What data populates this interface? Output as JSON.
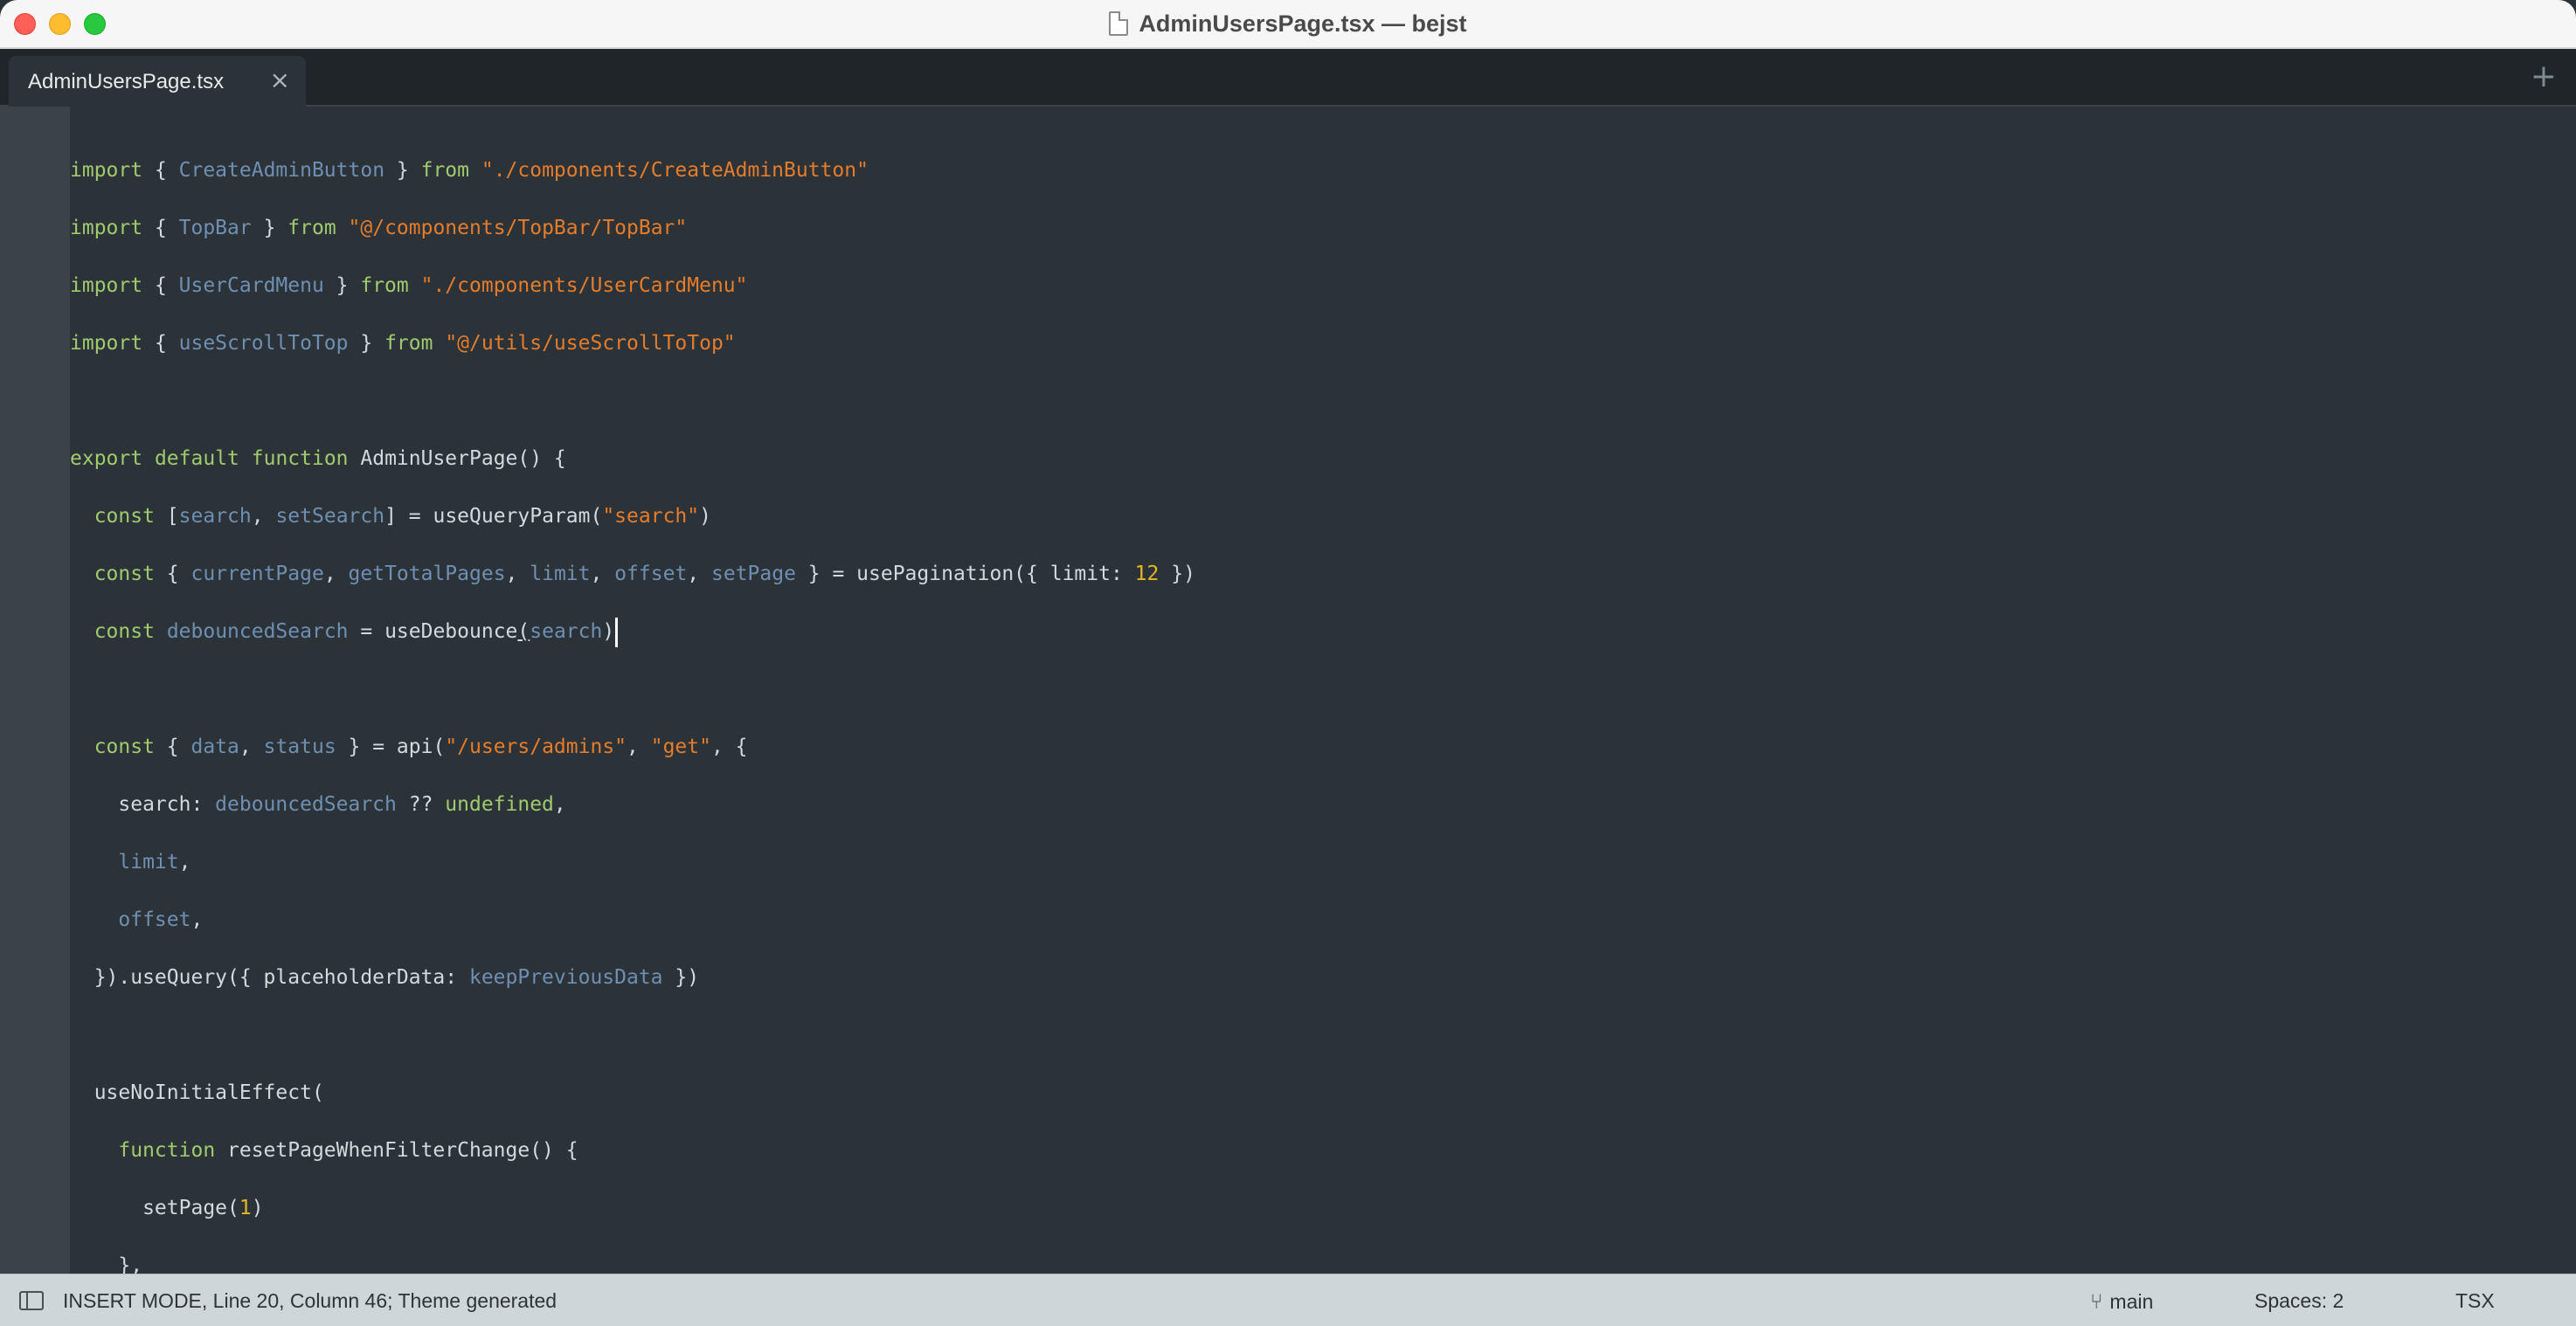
{
  "window": {
    "title": "AdminUsersPage.tsx — bejst"
  },
  "tabs": [
    {
      "label": "AdminUsersPage.tsx",
      "close": "×"
    }
  ],
  "new_tab_label": "+",
  "code": {
    "lines": [
      [
        [
          "kw",
          "import"
        ],
        [
          "p",
          " { "
        ],
        [
          "id",
          "CreateAdminButton"
        ],
        [
          "p",
          " } "
        ],
        [
          "kw",
          "from"
        ],
        [
          "p",
          " "
        ],
        [
          "str",
          "\"./components/CreateAdminButton\""
        ]
      ],
      [
        [
          "kw",
          "import"
        ],
        [
          "p",
          " { "
        ],
        [
          "id",
          "TopBar"
        ],
        [
          "p",
          " } "
        ],
        [
          "kw",
          "from"
        ],
        [
          "p",
          " "
        ],
        [
          "str",
          "\"@/components/TopBar/TopBar\""
        ]
      ],
      [
        [
          "kw",
          "import"
        ],
        [
          "p",
          " { "
        ],
        [
          "id",
          "UserCardMenu"
        ],
        [
          "p",
          " } "
        ],
        [
          "kw",
          "from"
        ],
        [
          "p",
          " "
        ],
        [
          "str",
          "\"./components/UserCardMenu\""
        ]
      ],
      [
        [
          "kw",
          "import"
        ],
        [
          "p",
          " { "
        ],
        [
          "id",
          "useScrollToTop"
        ],
        [
          "p",
          " } "
        ],
        [
          "kw",
          "from"
        ],
        [
          "p",
          " "
        ],
        [
          "str",
          "\"@/utils/useScrollToTop\""
        ]
      ],
      [],
      [
        [
          "kw",
          "export"
        ],
        [
          "p",
          " "
        ],
        [
          "kw",
          "default"
        ],
        [
          "p",
          " "
        ],
        [
          "kw",
          "function"
        ],
        [
          "p",
          " AdminUserPage() {"
        ]
      ],
      [
        [
          "p",
          "  "
        ],
        [
          "kw",
          "const"
        ],
        [
          "p",
          " ["
        ],
        [
          "id",
          "search"
        ],
        [
          "p",
          ", "
        ],
        [
          "id",
          "setSearch"
        ],
        [
          "p",
          "] = useQueryParam("
        ],
        [
          "str",
          "\"search\""
        ],
        [
          "p",
          ")"
        ]
      ],
      [
        [
          "p",
          "  "
        ],
        [
          "kw",
          "const"
        ],
        [
          "p",
          " { "
        ],
        [
          "id",
          "currentPage"
        ],
        [
          "p",
          ", "
        ],
        [
          "id",
          "getTotalPages"
        ],
        [
          "p",
          ", "
        ],
        [
          "id",
          "limit"
        ],
        [
          "p",
          ", "
        ],
        [
          "id",
          "offset"
        ],
        [
          "p",
          ", "
        ],
        [
          "id",
          "setPage"
        ],
        [
          "p",
          " } = usePagination({ limit: "
        ],
        [
          "num",
          "12"
        ],
        [
          "p",
          " })"
        ]
      ],
      [
        [
          "p",
          "  "
        ],
        [
          "kw",
          "const"
        ],
        [
          "p",
          " "
        ],
        [
          "id",
          "debouncedSearch"
        ],
        [
          "p",
          " = useDebounce"
        ],
        [
          "ul",
          "("
        ],
        [
          "id",
          "search"
        ],
        [
          "p",
          ")"
        ],
        [
          "cursor",
          ""
        ]
      ],
      [],
      [
        [
          "p",
          "  "
        ],
        [
          "kw",
          "const"
        ],
        [
          "p",
          " { "
        ],
        [
          "id",
          "data"
        ],
        [
          "p",
          ", "
        ],
        [
          "id",
          "status"
        ],
        [
          "p",
          " } = api("
        ],
        [
          "str",
          "\"/users/admins\""
        ],
        [
          "p",
          ", "
        ],
        [
          "str",
          "\"get\""
        ],
        [
          "p",
          ", {"
        ]
      ],
      [
        [
          "p",
          "    search: "
        ],
        [
          "id",
          "debouncedSearch"
        ],
        [
          "p",
          " ?? "
        ],
        [
          "kw",
          "undefined"
        ],
        [
          "p",
          ","
        ]
      ],
      [
        [
          "p",
          "    "
        ],
        [
          "id",
          "limit"
        ],
        [
          "p",
          ","
        ]
      ],
      [
        [
          "p",
          "    "
        ],
        [
          "id",
          "offset"
        ],
        [
          "p",
          ","
        ]
      ],
      [
        [
          "p",
          "  }).useQuery({ placeholderData: "
        ],
        [
          "id",
          "keepPreviousData"
        ],
        [
          "p",
          " })"
        ]
      ],
      [],
      [
        [
          "p",
          "  useNoInitialEffect("
        ]
      ],
      [
        [
          "p",
          "    "
        ],
        [
          "kw",
          "function"
        ],
        [
          "p",
          " resetPageWhenFilterChange() {"
        ]
      ],
      [
        [
          "p",
          "      setPage("
        ],
        [
          "num",
          "1"
        ],
        [
          "p",
          ")"
        ]
      ],
      [
        [
          "p",
          "    },"
        ]
      ]
    ]
  },
  "statusbar": {
    "mode_text": "INSERT MODE, Line 20, Column 46; Theme generated",
    "branch_icon": "git-branch-icon",
    "branch": "main",
    "spaces": "Spaces: 2",
    "syntax": "TSX"
  },
  "colors": {
    "keyword": "#9fca6e",
    "identifier": "#6f8fb2",
    "string": "#e57c2b",
    "number": "#e3b726",
    "text": "#d3d9dc",
    "background": "#2b3338"
  }
}
